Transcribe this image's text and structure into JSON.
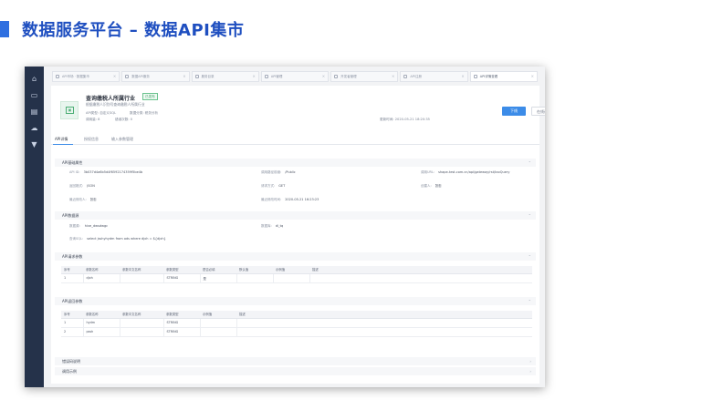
{
  "slide": {
    "title": "数据服务平台 – 数据API集市"
  },
  "sidebar": {
    "icons": [
      "home-icon",
      "folder-icon",
      "document-icon",
      "cloud-icon",
      "filter-icon"
    ]
  },
  "tabs": [
    {
      "label": "API市场 · 数据集市"
    },
    {
      "label": "数据API服务"
    },
    {
      "label": "服务目录"
    },
    {
      "label": "API管理"
    },
    {
      "label": "开发者管理"
    },
    {
      "label": "API注册"
    },
    {
      "label": "API详情查看"
    }
  ],
  "api": {
    "name": "查询缴税人所属行业",
    "badge": "已发布",
    "subtitle": "根据缴税人识别号查询缴税人所属行业",
    "meta": {
      "type_label": "API类型:",
      "type_value": "自定义SQL",
      "category_label": "数据分类:",
      "category_value": "税务分析",
      "calls_label": "调用量:",
      "calls_value": "8",
      "errors_label": "错误次数:",
      "errors_value": "0",
      "updated_label": "更新时间:",
      "updated_value": "2020-05-21 18:20:35"
    },
    "buttons": {
      "primary": "下线",
      "secondary": "在线调试"
    }
  },
  "subtabs": [
    "API详情",
    "授权信息",
    "输入参数管理"
  ],
  "sections": {
    "basic": {
      "title": "API基础属性",
      "rows": [
        {
          "k": "API ID:",
          "v": "3b037d4a6b5d4f6592174359f5be4b"
        },
        {
          "k": "调用路径前缀:",
          "v": "/Public"
        },
        {
          "k": "调用URL:",
          "v": "shape-test.com.cn/api/gateway/rst/taxQuery"
        },
        {
          "k": "返回格式:",
          "v": "JSON"
        },
        {
          "k": "请求方式:",
          "v": "GET"
        },
        {
          "k": "创建人:",
          "v": "张忠"
        },
        {
          "k": "最近修改人:",
          "v": "张忠"
        },
        {
          "k": "最近修改时间:",
          "v": "2020-05-21 16:23:23"
        }
      ]
    },
    "dataset": {
      "title": "API数据源",
      "rows": [
        {
          "k": "数据源: ",
          "v": "hive_dwsdwgc"
        },
        {
          "k": "数据库:",
          "v": "dl_tq"
        },
        {
          "k": "查询SQL:",
          "v": "select jsshyhydm from ods where djxh = ${djxh}"
        }
      ]
    },
    "request": {
      "title": "API请求参数",
      "headers": [
        "序号",
        "参数名称",
        "参数中文名称",
        "参数类型",
        "是否必填",
        "默认值",
        "示例值",
        "描述"
      ],
      "rows": [
        [
          "1",
          "djxh",
          "",
          "STRING",
          "是",
          "",
          "",
          ""
        ]
      ]
    },
    "response": {
      "title": "API返回参数",
      "headers": [
        "序号",
        "参数名称",
        "参数中文名称",
        "参数类型",
        "示例值",
        "描述"
      ],
      "rows": [
        [
          "1",
          "hydm",
          "",
          "STRING",
          "",
          ""
        ],
        [
          "2",
          "pssh",
          "",
          "STRING",
          "",
          ""
        ]
      ]
    },
    "fold1": "错误码说明",
    "fold2": "调用示例"
  }
}
